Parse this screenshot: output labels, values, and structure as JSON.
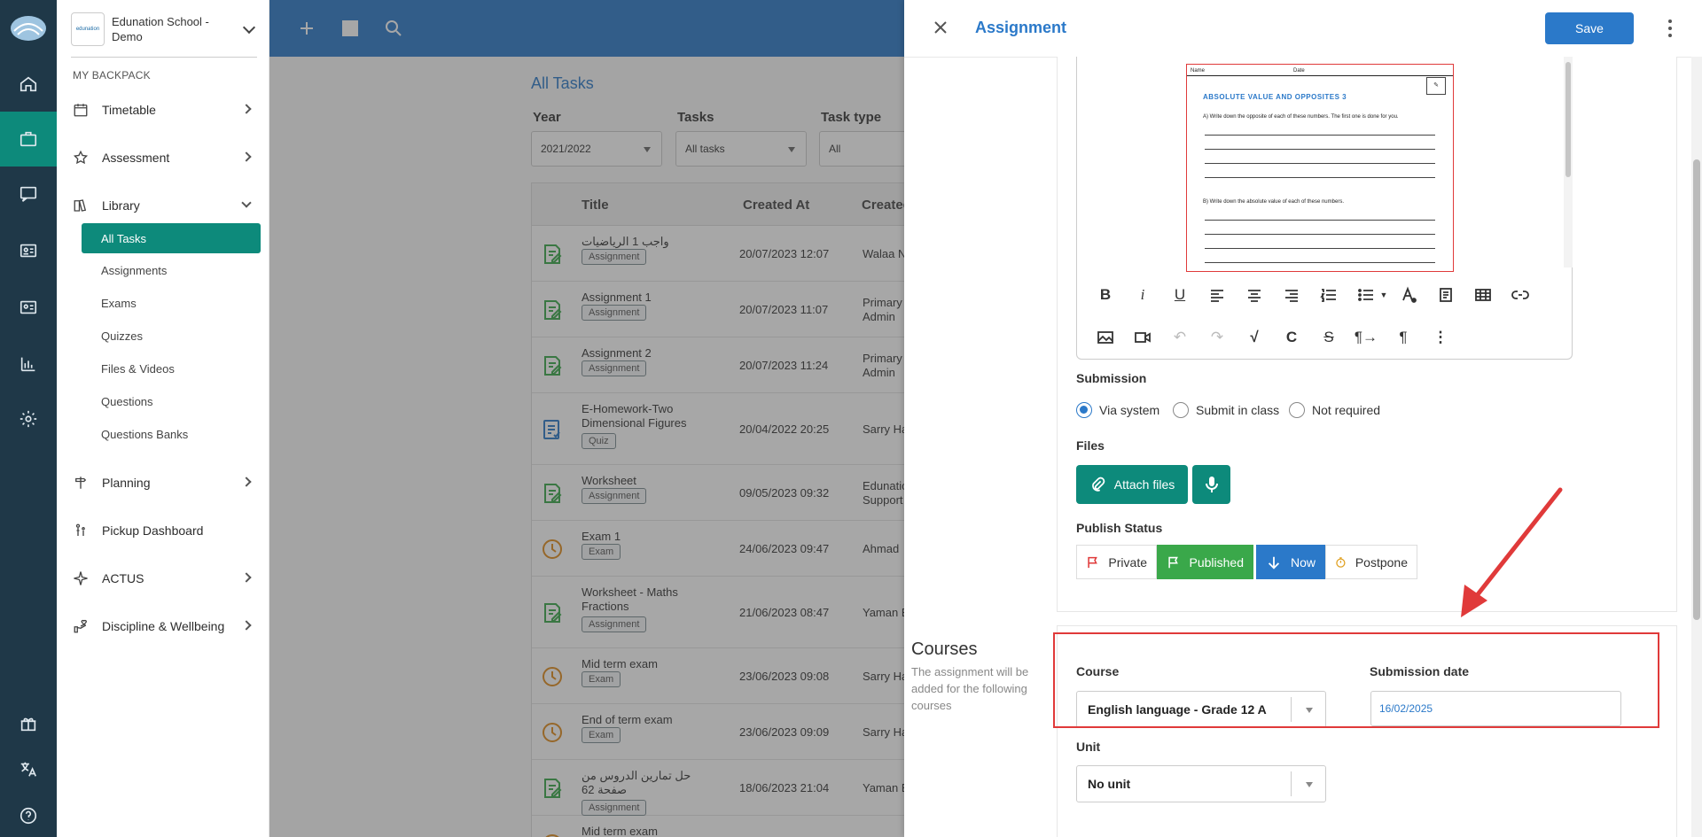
{
  "sidebar": {
    "school_logo_text": "edunation",
    "school_name": "Edunation School - Demo",
    "section_title": "MY BACKPACK",
    "items": [
      {
        "label": "Timetable"
      },
      {
        "label": "Assessment"
      },
      {
        "label": "Library"
      },
      {
        "label": "Planning"
      },
      {
        "label": "Pickup Dashboard"
      },
      {
        "label": "ACTUS"
      },
      {
        "label": "Discipline & Wellbeing"
      }
    ],
    "library_sub": [
      {
        "label": "All Tasks"
      },
      {
        "label": "Assignments"
      },
      {
        "label": "Exams"
      },
      {
        "label": "Quizzes"
      },
      {
        "label": "Files & Videos"
      },
      {
        "label": "Questions"
      },
      {
        "label": "Questions Banks"
      }
    ]
  },
  "content": {
    "title": "All Tasks",
    "filters": {
      "year_label": "Year",
      "year_value": "2021/2022",
      "tasks_label": "Tasks",
      "tasks_value": "All tasks",
      "type_label": "Task type",
      "type_value": "All"
    },
    "columns": {
      "title": "Title",
      "created_at": "Created At",
      "created_by": "Created"
    },
    "rows": [
      {
        "title": "واجب 1 الرياضيات",
        "badge": "Assignment",
        "date": "20/07/2023 12:07",
        "by": "Walaa N",
        "kind": "assignment"
      },
      {
        "title": "Assignment 1",
        "badge": "Assignment",
        "date": "20/07/2023 11:07",
        "by": "Primary\nAdmin",
        "kind": "assignment"
      },
      {
        "title": "Assignment 2",
        "badge": "Assignment",
        "date": "20/07/2023 11:24",
        "by": "Primary\nAdmin",
        "kind": "assignment"
      },
      {
        "title": "E-Homework-Two Dimensional Figures",
        "badge": "Quiz",
        "date": "20/04/2022 20:25",
        "by": "Sarry Ha",
        "kind": "quiz"
      },
      {
        "title": "Worksheet",
        "badge": "Assignment",
        "date": "09/05/2023 09:32",
        "by": "Edunatio\nSupport",
        "kind": "assignment"
      },
      {
        "title": "Exam 1",
        "badge": "Exam",
        "date": "24/06/2023 09:47",
        "by": "Ahmad",
        "kind": "exam"
      },
      {
        "title": "Worksheet - Maths Fractions",
        "badge": "Assignment",
        "date": "21/06/2023 08:47",
        "by": "Yaman E",
        "kind": "assignment"
      },
      {
        "title": "Mid term exam",
        "badge": "Exam",
        "date": "23/06/2023 09:08",
        "by": "Sarry Ha",
        "kind": "exam"
      },
      {
        "title": "End of term exam",
        "badge": "Exam",
        "date": "23/06/2023 09:09",
        "by": "Sarry Ha",
        "kind": "exam"
      },
      {
        "title": "حل تمارين الدروس من صفحة 62",
        "badge": "Assignment",
        "date": "18/06/2023 21:04",
        "by": "Yaman E",
        "kind": "assignment"
      },
      {
        "title": "Mid term exam",
        "badge": "",
        "date": "",
        "by": "",
        "kind": "exam"
      }
    ]
  },
  "panel": {
    "title": "Assignment",
    "save_label": "Save",
    "document": {
      "heading": "ABSOLUTE VALUE AND OPPOSITES 3",
      "name_label": "Name",
      "date_label": "Date",
      "instruction_a": "A) Write down the opposite of each of these numbers. The first one is done for you.",
      "instruction_b": "B) Write down the absolute value of each of these numbers."
    },
    "submission": {
      "label": "Submission",
      "options": [
        "Via system",
        "Submit in class",
        "Not required"
      ],
      "selected": "Via system"
    },
    "files": {
      "label": "Files",
      "attach_label": "Attach files"
    },
    "publish": {
      "label": "Publish Status",
      "private": "Private",
      "published": "Published",
      "now": "Now",
      "postpone": "Postpone"
    },
    "courses": {
      "title": "Courses",
      "description": "The assignment will be added for the following courses",
      "course_label": "Course",
      "course_value": "English language - Grade 12 A",
      "date_label": "Submission date",
      "date_value": "16/02/2025",
      "unit_label": "Unit",
      "unit_value": "No unit"
    },
    "colors": {
      "accent": "#2b79c9",
      "teal": "#0d8a7b",
      "published": "#3aa84a",
      "highlight": "#e03a3a"
    }
  }
}
